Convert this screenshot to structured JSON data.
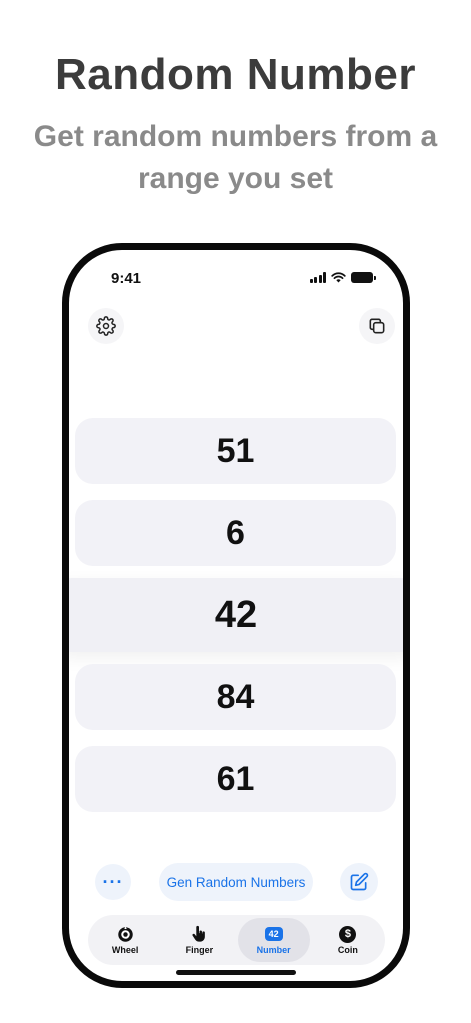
{
  "hero": {
    "title": "Random Number",
    "subtitle": "Get random numbers from a range you set"
  },
  "status_bar": {
    "time": "9:41"
  },
  "numbers": [
    "51",
    "6",
    "42",
    "84",
    "61"
  ],
  "selected_index": 2,
  "actions": {
    "more_label": "···",
    "generate_label": "Gen Random Numbers"
  },
  "tabs": [
    {
      "label": "Wheel",
      "icon": "wheel-icon"
    },
    {
      "label": "Finger",
      "icon": "finger-icon"
    },
    {
      "label": "Number",
      "icon": "number-badge-icon",
      "badge": "42",
      "active": true
    },
    {
      "label": "Coin",
      "icon": "coin-icon",
      "symbol": "$"
    }
  ],
  "colors": {
    "accent": "#1a73e8",
    "card_bg": "#f2f2f7",
    "title": "#3c3c3c",
    "subtitle": "#8a8a8a"
  }
}
